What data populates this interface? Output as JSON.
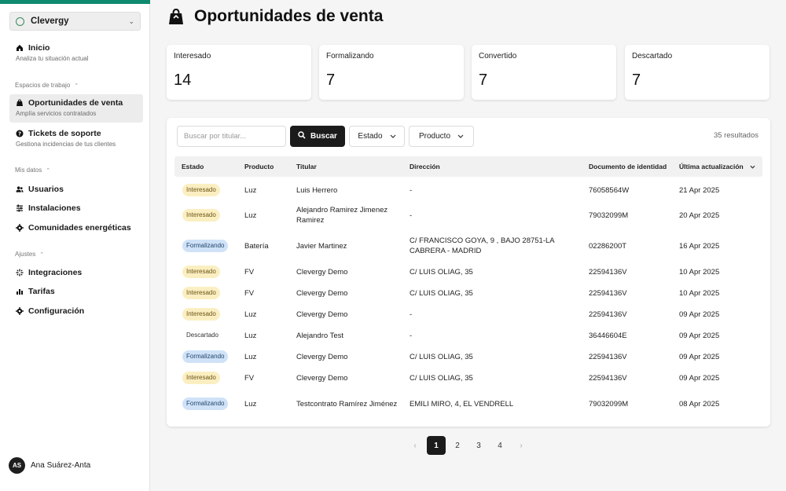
{
  "sidebar": {
    "org_name": "Clevergy",
    "nav": [
      {
        "label": "Inicio",
        "sub": "Analiza tu situación actual",
        "icon": "home-icon"
      },
      {
        "label": "Oportunidades de venta",
        "sub": "Amplía servicios contratados",
        "icon": "shopping-bag-icon"
      },
      {
        "label": "Tickets de soporte",
        "sub": "Gestiona incidencias de tus clientes",
        "icon": "help-circle-icon"
      },
      {
        "label": "Usuarios",
        "icon": "users-icon"
      },
      {
        "label": "Instalaciones",
        "icon": "sliders-icon"
      },
      {
        "label": "Comunidades energéticas",
        "icon": "gear-icon"
      },
      {
        "label": "Integraciones",
        "icon": "sparkle-icon"
      },
      {
        "label": "Tarifas",
        "icon": "bar-chart-icon"
      },
      {
        "label": "Configuración",
        "icon": "gear-icon"
      }
    ],
    "sections": {
      "workspaces": "Espacios de trabajo",
      "my_data": "Mis datos",
      "settings": "Ajustes"
    },
    "user": {
      "initials": "AS",
      "name": "Ana Suárez-Anta"
    }
  },
  "page": {
    "title": "Oportunidades de venta"
  },
  "stats": [
    {
      "label": "Interesado",
      "value": "14"
    },
    {
      "label": "Formalizando",
      "value": "7"
    },
    {
      "label": "Convertido",
      "value": "7"
    },
    {
      "label": "Descartado",
      "value": "7"
    }
  ],
  "toolbar": {
    "search_placeholder": "Buscar por titular...",
    "search_label": "Buscar",
    "filter_estado": "Estado",
    "filter_producto": "Producto",
    "results": "35 resultados"
  },
  "table": {
    "headers": [
      "Estado",
      "Producto",
      "Titular",
      "Dirección",
      "Documento de identidad",
      "Última actualización"
    ],
    "rows": [
      {
        "estado": "Interesado",
        "tipo": "interesado",
        "producto": "Luz",
        "titular": "Luis Herrero",
        "direccion": "-",
        "doc": "76058564W",
        "fecha": "21 Apr 2025"
      },
      {
        "estado": "Interesado",
        "tipo": "interesado",
        "producto": "Luz",
        "titular": "Alejandro Ramirez Jimenez Ramirez",
        "direccion": "-",
        "doc": "79032099M",
        "fecha": "20 Apr 2025"
      },
      {
        "estado": "Formalizando",
        "tipo": "formalizando",
        "producto": "Batería",
        "titular": "Javier Martinez",
        "direccion": "C/ FRANCISCO GOYA, 9 , BAJO 28751-LA CABRERA - MADRID",
        "doc": "02286200T",
        "fecha": "16 Apr 2025"
      },
      {
        "estado": "Interesado",
        "tipo": "interesado",
        "producto": "FV",
        "titular": "Clevergy Demo",
        "direccion": "C/ LUIS OLIAG, 35",
        "doc": "22594136V",
        "fecha": "10 Apr 2025"
      },
      {
        "estado": "Interesado",
        "tipo": "interesado",
        "producto": "FV",
        "titular": "Clevergy Demo",
        "direccion": "C/ LUIS OLIAG, 35",
        "doc": "22594136V",
        "fecha": "10 Apr 2025"
      },
      {
        "estado": "Interesado",
        "tipo": "interesado",
        "producto": "Luz",
        "titular": "Clevergy Demo",
        "direccion": "-",
        "doc": "22594136V",
        "fecha": "09 Apr 2025"
      },
      {
        "estado": "Descartado",
        "tipo": "descartado",
        "producto": "Luz",
        "titular": "Alejandro Test",
        "direccion": "-",
        "doc": "36446604E",
        "fecha": "09 Apr 2025"
      },
      {
        "estado": "Formalizando",
        "tipo": "formalizando",
        "producto": "Luz",
        "titular": "Clevergy Demo",
        "direccion": "C/ LUIS OLIAG, 35",
        "doc": "22594136V",
        "fecha": "09 Apr 2025"
      },
      {
        "estado": "Interesado",
        "tipo": "interesado",
        "producto": "FV",
        "titular": "Clevergy Demo",
        "direccion": "C/ LUIS OLIAG, 35",
        "doc": "22594136V",
        "fecha": "09 Apr 2025"
      },
      {
        "estado": "Formalizando",
        "tipo": "formalizando",
        "producto": "Luz",
        "titular": "Testcontrato Ramírez Jiménez",
        "direccion": "EMILI MIRO, 4, EL VENDRELL",
        "doc": "79032099M",
        "fecha": "08 Apr 2025"
      }
    ]
  },
  "pagination": {
    "pages": [
      "1",
      "2",
      "3",
      "4"
    ],
    "current": "1",
    "prev": "‹",
    "next": "›"
  },
  "colors": {
    "brand": "#0f8a6e",
    "primary_button": "#1b1b1b",
    "interesado_badge": "#fbefc2",
    "formalizando_badge": "#cfe2f7"
  }
}
